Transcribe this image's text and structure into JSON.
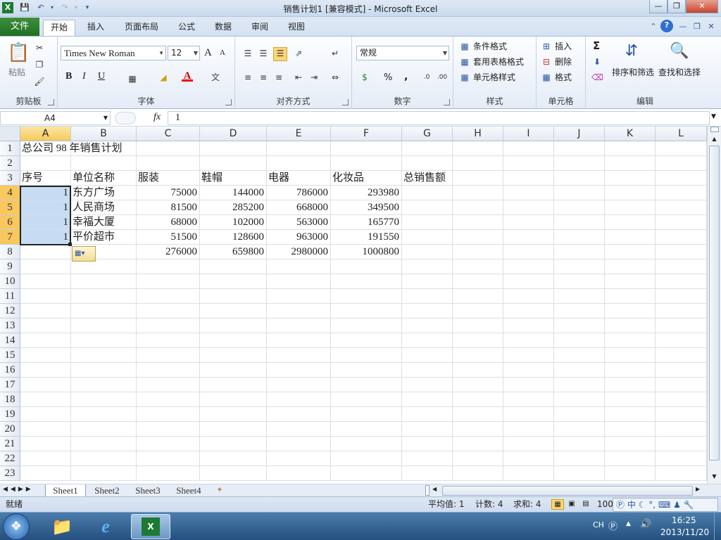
{
  "window": {
    "title": "销售计划1 [兼容模式] - Microsoft Excel"
  },
  "ribbon_tabs": {
    "file": "文件",
    "items": [
      "开始",
      "插入",
      "页面布局",
      "公式",
      "数据",
      "审阅",
      "视图"
    ]
  },
  "ribbon": {
    "clipboard": {
      "label": "剪贴板",
      "paste": "粘贴"
    },
    "font": {
      "label": "字体",
      "name": "Times New Roman",
      "size": "12",
      "grow": "A",
      "shrink": "A",
      "bold": "B",
      "italic": "I",
      "underline": "U"
    },
    "alignment": {
      "label": "对齐方式"
    },
    "number": {
      "label": "数字",
      "format": "常规",
      "percent": "%",
      "comma": ","
    },
    "styles": {
      "label": "样式",
      "conditional": "条件格式",
      "table": "套用表格格式",
      "cell": "单元格样式"
    },
    "cells": {
      "label": "单元格",
      "insert": "插入",
      "delete": "删除",
      "format": "格式"
    },
    "editing": {
      "label": "编辑",
      "sum": "Σ",
      "sort": "排序和筛选",
      "find": "查找和选择"
    }
  },
  "formula_bar": {
    "name_box": "A4",
    "fx": "fx",
    "value": "1"
  },
  "columns": [
    "A",
    "B",
    "C",
    "D",
    "E",
    "F",
    "G",
    "H",
    "I",
    "J",
    "K",
    "L"
  ],
  "rows": [
    "1",
    "2",
    "3",
    "4",
    "5",
    "6",
    "7",
    "8",
    "9",
    "10",
    "11",
    "12",
    "13",
    "14",
    "15",
    "16",
    "17",
    "18",
    "19",
    "20",
    "21",
    "22",
    "23"
  ],
  "sheet": {
    "title": "总公司 98 年销售计划",
    "headers": {
      "seq": "序号",
      "unit": "单位名称",
      "c": "服装",
      "d": "鞋帽",
      "e": "电器",
      "f": "化妆品",
      "g": "总销售额"
    },
    "data": [
      {
        "seq": "1",
        "name": "东方广场",
        "c": "75000",
        "d": "144000",
        "e": "786000",
        "f": "293980"
      },
      {
        "seq": "1",
        "name": "人民商场",
        "c": "81500",
        "d": "285200",
        "e": "668000",
        "f": "349500"
      },
      {
        "seq": "1",
        "name": "幸福大厦",
        "c": "68000",
        "d": "102000",
        "e": "563000",
        "f": "165770"
      },
      {
        "seq": "1",
        "name": "平价超市",
        "c": "51500",
        "d": "128600",
        "e": "963000",
        "f": "191550"
      }
    ],
    "totals": {
      "c": "276000",
      "d": "659800",
      "e": "2980000",
      "f": "1000800"
    }
  },
  "sheet_tabs": [
    "Sheet1",
    "Sheet2",
    "Sheet3",
    "Sheet4"
  ],
  "status": {
    "ready": "就绪",
    "average": "平均值: 1",
    "count": "计数: 4",
    "sum": "求和: 4",
    "zoom": "100"
  },
  "ime": {
    "lang": "中"
  },
  "taskbar": {
    "lang": "CH",
    "time": "16:25",
    "date": "2013/11/20"
  },
  "colors": {
    "file_tab": "#2a7d2a",
    "selection": "#c6dcf3",
    "header_selected": "#f8c85d"
  }
}
